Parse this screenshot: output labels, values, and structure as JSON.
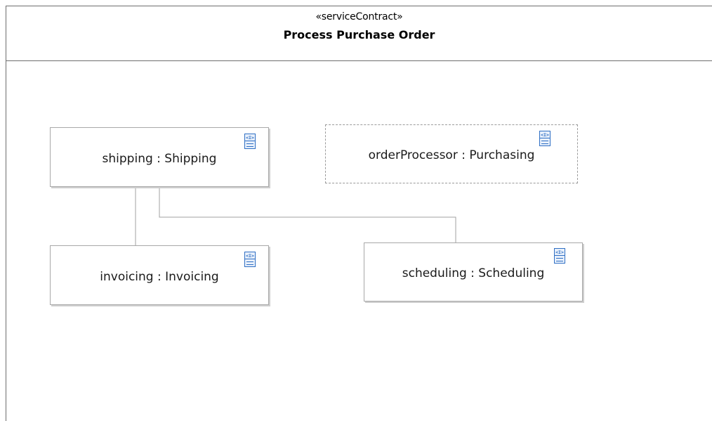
{
  "contract": {
    "stereotype": "«serviceContract»",
    "title": "Process Purchase Order"
  },
  "parts": {
    "shipping": {
      "label": "shipping : Shipping",
      "icon": "interface-icon"
    },
    "orderProcessor": {
      "label": "orderProcessor : Purchasing",
      "icon": "interface-icon"
    },
    "invoicing": {
      "label": "invoicing : Invoicing",
      "icon": "interface-icon"
    },
    "scheduling": {
      "label": "scheduling : Scheduling",
      "icon": "interface-icon"
    }
  },
  "colors": {
    "border": "#6e6e6e",
    "part_border": "#a8a8a8",
    "connector": "#a0a0a0",
    "icon_blue": "#2f6fc4"
  }
}
